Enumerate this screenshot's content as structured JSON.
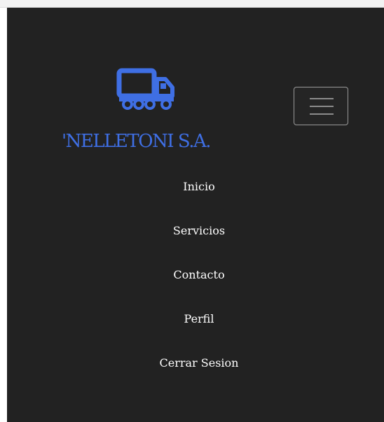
{
  "brand": {
    "name": "'NELLETONI S.A.",
    "icon": "truck-icon",
    "color": "#3f6fe4"
  },
  "navbar": {
    "background": "#222222",
    "toggler_icon": "hamburger-menu-icon"
  },
  "menu": {
    "items": [
      {
        "label": "Inicio"
      },
      {
        "label": "Servicios"
      },
      {
        "label": "Contacto"
      },
      {
        "label": "Perfil"
      },
      {
        "label": "Cerrar Sesion"
      }
    ]
  }
}
